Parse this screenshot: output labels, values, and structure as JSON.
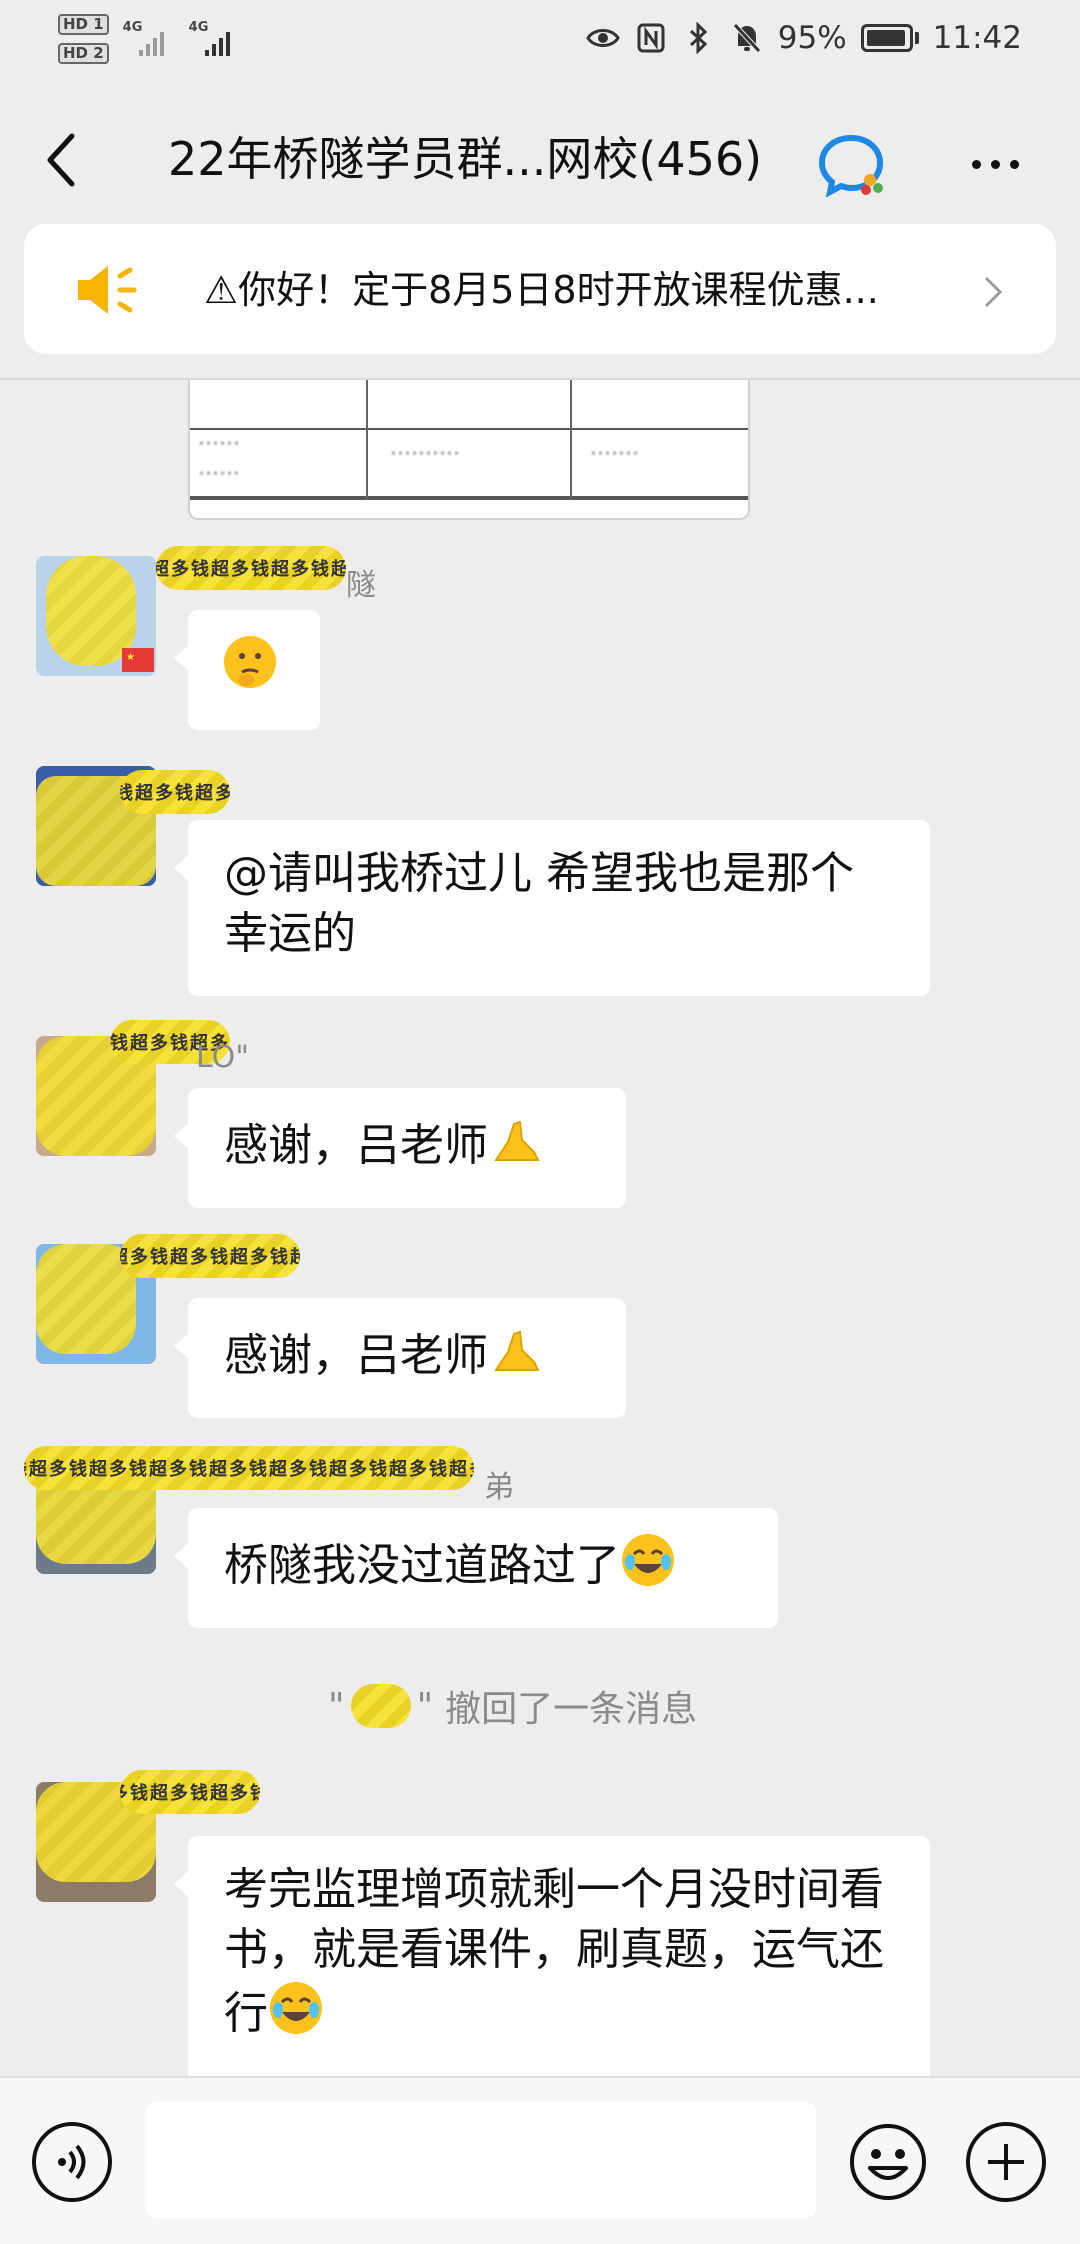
{
  "status_bar": {
    "sim1": "HD 1",
    "sim2": "HD 2",
    "net1": "4G",
    "net2": "4G",
    "battery": "95%",
    "battery_level": 0.95,
    "time": "11:42",
    "icons": [
      "eye-icon",
      "nfc-icon",
      "bluetooth-icon",
      "mute-bell-icon",
      "battery-icon"
    ]
  },
  "header": {
    "title": "22年桥隧学员群...网校(456)"
  },
  "notice": {
    "text": "⚠你好！定于8月5日8时开放课程优惠..."
  },
  "messages": [
    {
      "name_tail": "隧",
      "text": "",
      "emoji": "thinking-face-emoji"
    },
    {
      "name_tail": "",
      "text": "@请叫我桥过儿  希望我也是那个幸运的"
    },
    {
      "name_tail": "LO\"",
      "text": "感谢，吕老师",
      "emoji": "pinched-fingers-emoji"
    },
    {
      "name_tail": "",
      "text": "感谢，吕老师",
      "emoji": "pinched-fingers-emoji"
    },
    {
      "name_tail": "弟",
      "text": "桥隧我没过道路过了",
      "emoji": "crying-laughing-emoji"
    },
    {
      "name_tail": "",
      "text": "考完监理增项就剩一个月没时间看书，就是看课件，刷真题，运气还行",
      "emoji": "crying-laughing-emoji"
    }
  ],
  "recall": {
    "quote_open": "\"",
    "quote_close": "\"",
    "text": "撤回了一条消息"
  },
  "watermark": "钱超多钱超多",
  "colors": {
    "background": "#ededed",
    "bubble": "#ffffff",
    "notice_icon": "#f5b400",
    "title_icon_blue": "#1e88e5"
  }
}
